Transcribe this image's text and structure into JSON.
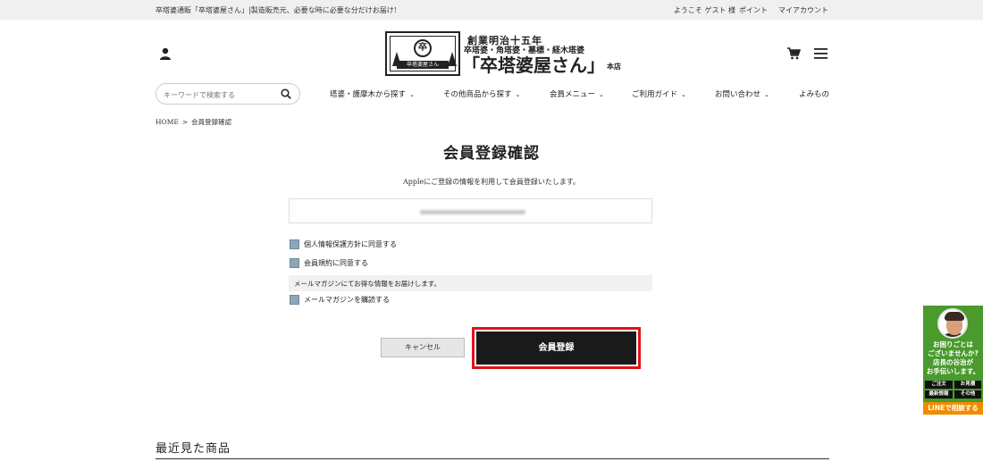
{
  "topbar": {
    "tagline": "卒塔婆通販「卒塔婆屋さん」|製造販売元、必要な時に必要な分だけお届け!",
    "welcome": "ようこそ ゲスト 様",
    "points": "ポイント",
    "account": "マイアカウント"
  },
  "logo": {
    "line1": "創業明治十五年",
    "line2": "卒塔婆・角塔婆・墓標・経木塔婆",
    "name": "「卒塔婆屋さん」",
    "suffix": "本店",
    "seal": "卒",
    "plate": "卒塔婆屋さん"
  },
  "search": {
    "placeholder": "キーワードで検索する"
  },
  "nav": [
    {
      "label": "塔婆・護摩木から探す"
    },
    {
      "label": "その他商品から探す"
    },
    {
      "label": "会員メニュー"
    },
    {
      "label": "ご利用ガイド"
    },
    {
      "label": "お問い合わせ"
    },
    {
      "label": "よみもの"
    }
  ],
  "breadcrumb": {
    "home": "HOME",
    "separator": ">",
    "current": "会員登録確認"
  },
  "main": {
    "title": "会員登録確認",
    "lead": "Appleにご登録の情報を利用して会員登録いたします。",
    "checks": {
      "privacy": "個人情報保護方針に同意する",
      "terms": "会員規約に同意する"
    },
    "magazine_note": "メールマガジンにてお得な情報をお届けします。",
    "magazine_check": "メールマガジンを購読する",
    "cancel": "キャンセル",
    "register": "会員登録"
  },
  "recent": {
    "title": "最近見た商品"
  },
  "help": {
    "line1": "お困りごとは",
    "line2": "ございませんか?",
    "line3": "店長の谷治が",
    "line4": "お手伝いします。",
    "btn_order": "ご注文",
    "btn_quote": "お見積",
    "btn_news": "最新情報",
    "btn_other": "その他",
    "line_cta": "LINEで相談する"
  },
  "colors": {
    "accent_highlight": "#e0131a",
    "checkbox": "#8da7b7",
    "help_green": "#4a9a2e",
    "line_orange": "#f08c00"
  }
}
